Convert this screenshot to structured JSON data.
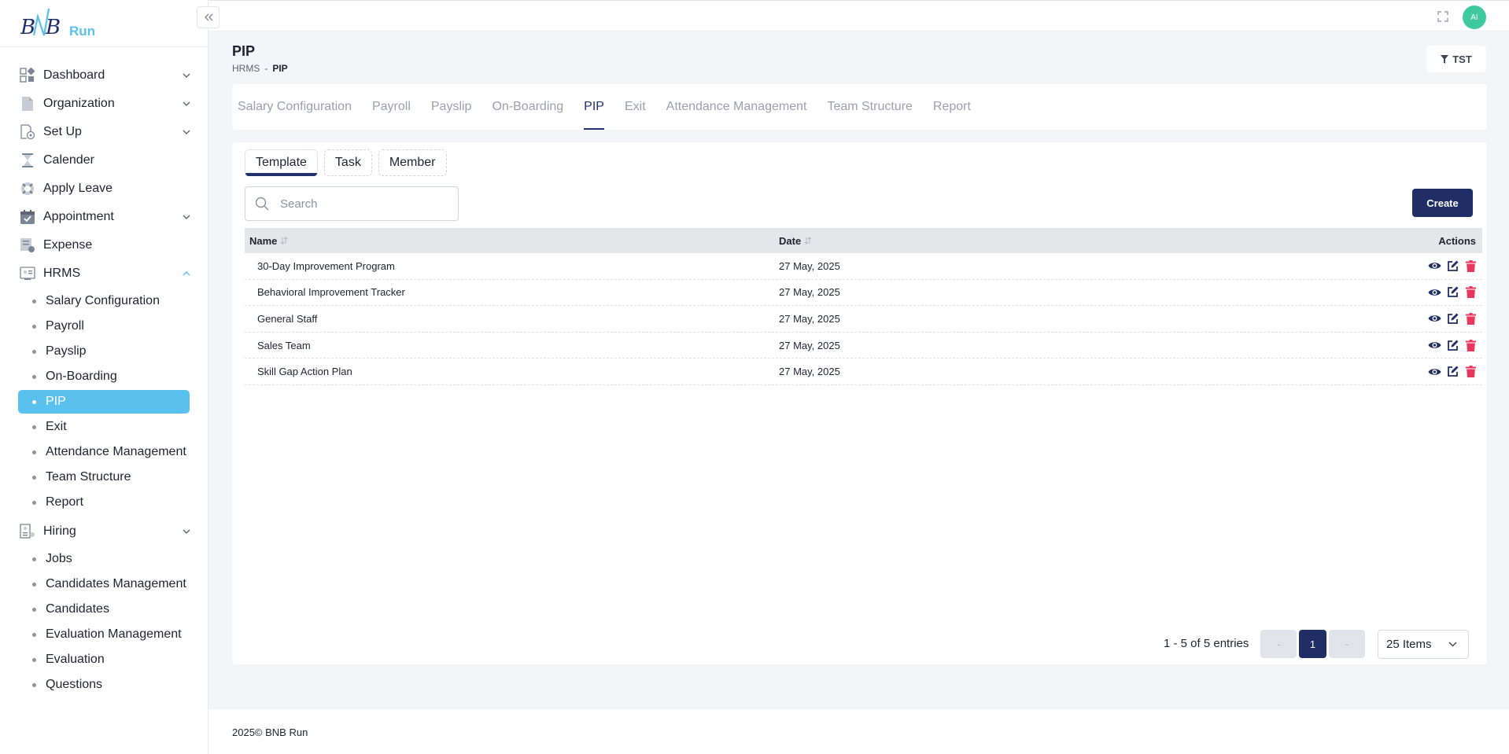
{
  "logo": {
    "text_a": "BNB",
    "text_b": "Run"
  },
  "sidebar": {
    "items": [
      {
        "label": "Dashboard",
        "icon": "dashboard-icon",
        "expandable": true
      },
      {
        "label": "Organization",
        "icon": "document-icon",
        "expandable": true
      },
      {
        "label": "Set Up",
        "icon": "setup-icon",
        "expandable": true
      },
      {
        "label": "Calender",
        "icon": "hourglass-icon",
        "expandable": false
      },
      {
        "label": "Apply Leave",
        "icon": "lifebuoy-icon",
        "expandable": false
      },
      {
        "label": "Appointment",
        "icon": "calendar-check-icon",
        "expandable": true
      },
      {
        "label": "Expense",
        "icon": "expense-icon",
        "expandable": false
      },
      {
        "label": "HRMS",
        "icon": "hrms-icon",
        "expandable": true,
        "expanded": true
      },
      {
        "label": "Hiring",
        "icon": "hiring-icon",
        "expandable": true,
        "expanded": true
      }
    ],
    "hrms_sub": [
      "Salary Configuration",
      "Payroll",
      "Payslip",
      "On-Boarding",
      "PIP",
      "Exit",
      "Attendance Management",
      "Team Structure",
      "Report"
    ],
    "hiring_sub": [
      "Jobs",
      "Candidates Management",
      "Candidates",
      "Evaluation Management",
      "Evaluation",
      "Questions"
    ],
    "active_sub": "PIP"
  },
  "topbar": {
    "avatar_initials": "AI"
  },
  "header": {
    "title": "PIP",
    "breadcrumb": [
      "HRMS",
      "-",
      "PIP"
    ],
    "filter_label": "TST"
  },
  "module_tabs": [
    "Salary Configuration",
    "Payroll",
    "Payslip",
    "On-Boarding",
    "PIP",
    "Exit",
    "Attendance Management",
    "Team Structure",
    "Report"
  ],
  "active_module_tab": "PIP",
  "sub_tabs": [
    "Template",
    "Task",
    "Member"
  ],
  "active_sub_tab": "Template",
  "search": {
    "placeholder": "Search",
    "value": ""
  },
  "create_label": "Create",
  "table": {
    "columns": {
      "name": "Name",
      "date": "Date",
      "actions": "Actions"
    },
    "rows": [
      {
        "name": "30-Day Improvement Program",
        "date": "27 May, 2025"
      },
      {
        "name": "Behavioral Improvement Tracker",
        "date": "27 May, 2025"
      },
      {
        "name": "General Staff",
        "date": "27 May, 2025"
      },
      {
        "name": "Sales Team",
        "date": "27 May, 2025"
      },
      {
        "name": "Skill Gap Action Plan",
        "date": "27 May, 2025"
      }
    ]
  },
  "pagination": {
    "summary": "1 - 5 of 5 entries",
    "prev": "-",
    "current": "1",
    "next": "-",
    "per_page": "25 Items"
  },
  "footer": {
    "text": "2025© BNB Run"
  },
  "colors": {
    "primary": "#1f2e65",
    "active_sidebar": "#5ac0ee",
    "delete": "#e8365d",
    "avatar": "#3ec99e"
  }
}
